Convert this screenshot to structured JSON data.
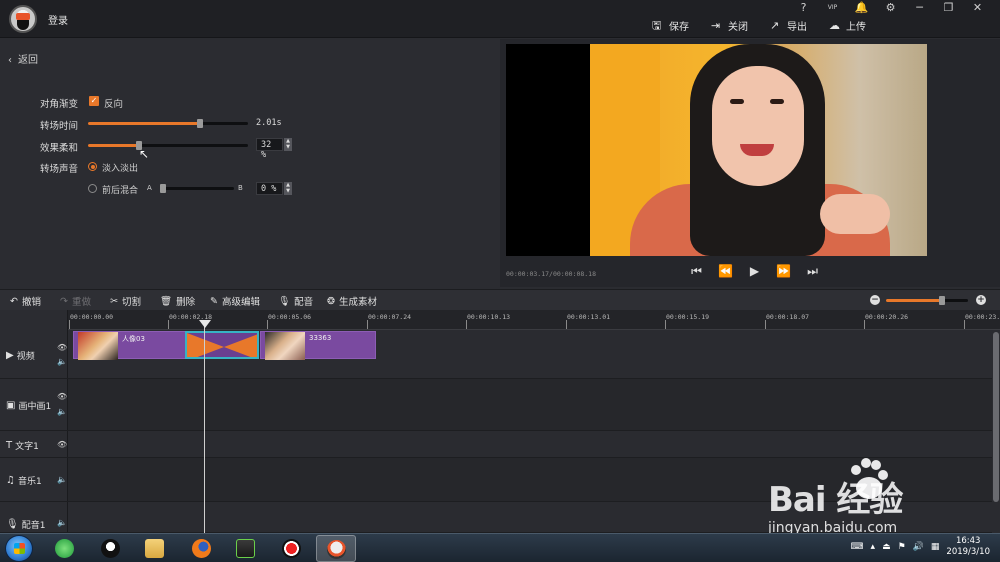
{
  "titlebar": {
    "login": "登录",
    "window_icons": [
      "?",
      "VIP",
      "🔔",
      "⚙",
      "─",
      "❐",
      "✕"
    ],
    "actions": [
      {
        "icon": "save-icon",
        "label": "保存"
      },
      {
        "icon": "close-doc-icon",
        "label": "关闭"
      },
      {
        "icon": "export-icon",
        "label": "导出"
      },
      {
        "icon": "upload-icon",
        "label": "上传"
      }
    ]
  },
  "props": {
    "back": "返回",
    "diagonal_label": "对角渐变",
    "reverse_label": "反向",
    "duration_label": "转场时间",
    "duration_value": "2.01s",
    "duration_fraction": 0.7,
    "softness_label": "效果柔和",
    "softness_value": "32 %",
    "softness_fraction": 0.32,
    "audio_label": "转场声音",
    "fade_label": "淡入淡出",
    "mix_label": "前后混合",
    "mix_a": "A",
    "mix_b": "B",
    "mix_value": "0 %"
  },
  "preview": {
    "timecode": "00:00:03.17/00:00:08.18",
    "controls": [
      "⏮",
      "⏪",
      "▶",
      "⏩",
      "⏭"
    ]
  },
  "toolbar": {
    "undo": "撤销",
    "redo": "重做",
    "cut": "切割",
    "delete": "删除",
    "advanced": "高级编辑",
    "dub": "配音",
    "generate": "生成素材"
  },
  "ruler": [
    "00:00:00.00",
    "00:00:02.18",
    "00:00:05.06",
    "00:00:07.24",
    "00:00:10.13",
    "00:00:13.01",
    "00:00:15.19",
    "00:00:18.07",
    "00:00:20.26",
    "00:00:23."
  ],
  "tracks": {
    "video": "视频",
    "pip": "画中画1",
    "text": "文字1",
    "music": "音乐1",
    "voice": "配音1"
  },
  "clips": {
    "clip1": "人像03",
    "clip2": "33363"
  },
  "taskbar": {
    "time": "16:43",
    "date": "2019/3/10"
  },
  "watermark": {
    "brand": "Bai  经验",
    "url": "jingyan.baidu.com"
  }
}
